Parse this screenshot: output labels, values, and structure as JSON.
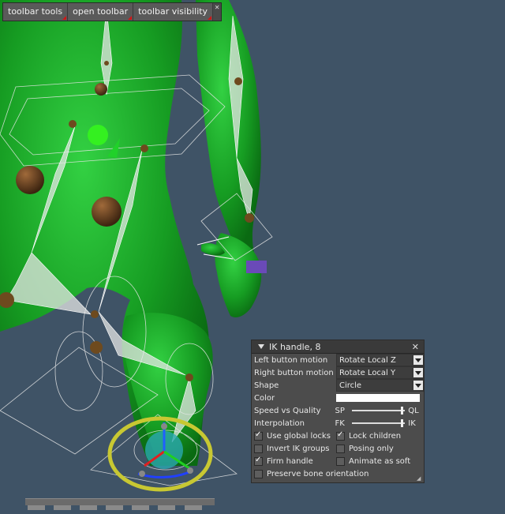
{
  "toolbar": {
    "tools_label": "toolbar tools",
    "open_label": "open toolbar",
    "visibility_label": "toolbar visibility"
  },
  "ik_panel": {
    "title": "IK handle, 8",
    "left_button_motion": {
      "label": "Left button motion",
      "value": "Rotate Local Z"
    },
    "right_button_motion": {
      "label": "Right button motion",
      "value": "Rotate Local Y"
    },
    "shape": {
      "label": "Shape",
      "value": "Circle"
    },
    "color": {
      "label": "Color",
      "value": "#ffffff"
    },
    "speed_quality": {
      "label": "Speed vs Quality",
      "low": "SP",
      "high": "QL",
      "level": 0.95
    },
    "interpolation": {
      "label": "Interpolation",
      "low": "FK",
      "high": "IK",
      "level": 0.95
    },
    "checkboxes": {
      "use_global_locks": {
        "label": "Use global locks",
        "checked": true
      },
      "lock_children": {
        "label": "Lock children",
        "checked": true
      },
      "invert_ik_groups": {
        "label": "Invert IK groups",
        "checked": false
      },
      "posing_only": {
        "label": "Posing only",
        "checked": false
      },
      "firm_handle": {
        "label": "Firm handle",
        "checked": true
      },
      "animate_as_soft": {
        "label": "Animate as soft",
        "checked": false
      },
      "preserve_bone_orientation": {
        "label": "Preserve bone orientation",
        "checked": false
      }
    }
  },
  "colors": {
    "viewport_bg": "#3f5366",
    "model_green": "#1fa82a",
    "selection_ring": "#c8c832"
  }
}
